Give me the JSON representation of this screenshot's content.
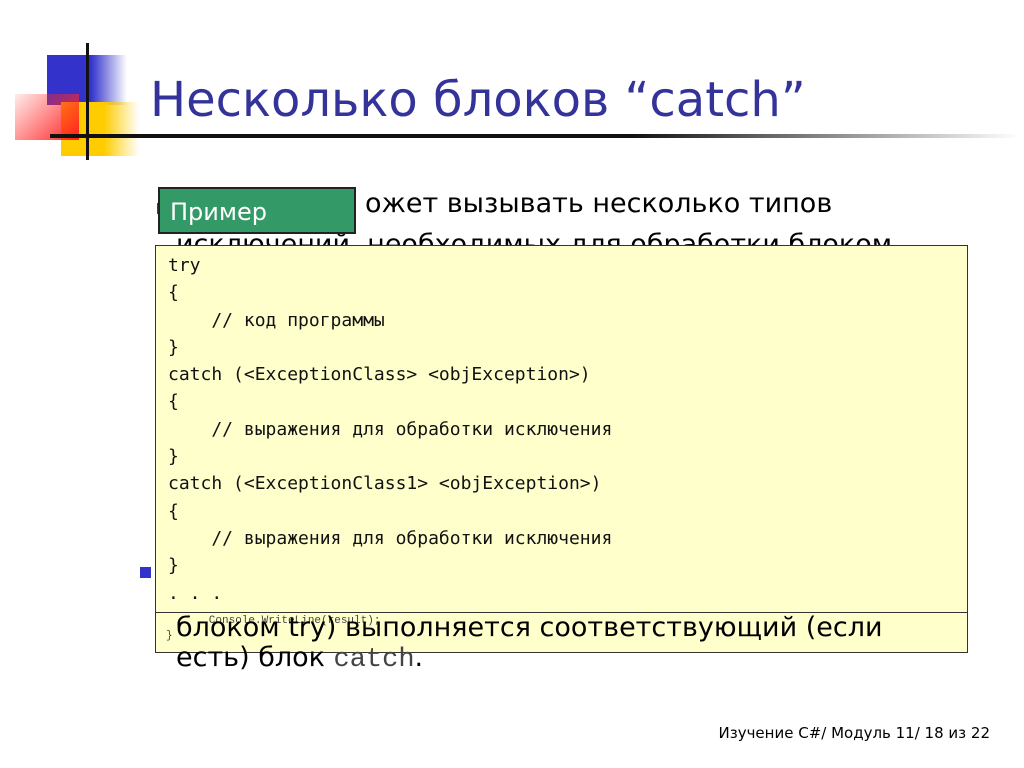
{
  "title": "Несколько блоков “catch”",
  "bullets": {
    "b1_line1_visible": "ожет вызывать несколько типов",
    "b1_line2_visible": "исключений, необходимых для обработки блоком",
    "b3_line1_visible": "блоком try) выполняется соответствующий (если",
    "b3_line2_text": "есть) блок ",
    "b3_line2_code": "catch",
    "b3_line2_end": "."
  },
  "lower_box": {
    "lines": [
      "        Console.WriteLine(result);",
      "}"
    ]
  },
  "example_label": "Пример",
  "code_lines": [
    "try",
    "{",
    "    // код программы",
    "}",
    "catch (<ExceptionClass> <objException>)",
    "{",
    "    // выражения для обработки исключения",
    "}",
    "catch (<ExceptionClass1> <objException>)",
    "{",
    "    // выражения для обработки исключения",
    "}",
    ". . ."
  ],
  "footer": "Изучение C#/ Модуль 11/ 18 из 22",
  "colors": {
    "title": "#333399",
    "label_bg": "#339966",
    "code_bg": "#ffffcc",
    "bullet": "#3333cc"
  }
}
